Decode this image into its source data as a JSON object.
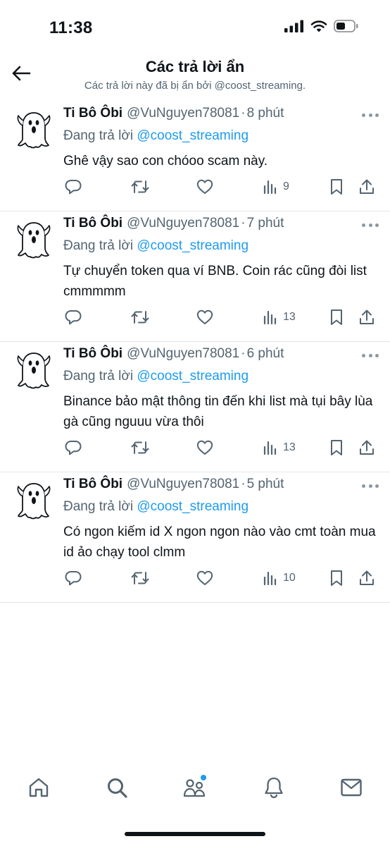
{
  "status_bar": {
    "time": "11:38"
  },
  "header": {
    "title": "Các trả lời ẩn",
    "subtitle": "Các trả lời này đã bị ẩn bởi @coost_streaming."
  },
  "replies": [
    {
      "author": "Ti Bô Ôbi",
      "handle": "@VuNguyen78081",
      "time": "8 phút",
      "replying_prefix": "Đang trả lời",
      "replying_to": "@coost_streaming",
      "text": "Ghê vậy sao con chóoo scam này.",
      "views": "9"
    },
    {
      "author": "Ti Bô Ôbi",
      "handle": "@VuNguyen78081",
      "time": "7 phút",
      "replying_prefix": "Đang trả lời",
      "replying_to": "@coost_streaming",
      "text": "Tự chuyển token qua ví BNB. Coin rác cũng đòi list cmmmmm",
      "views": "13"
    },
    {
      "author": "Ti Bô Ôbi",
      "handle": "@VuNguyen78081",
      "time": "6 phút",
      "replying_prefix": "Đang trả lời",
      "replying_to": "@coost_streaming",
      "text": "Binance bảo mật thông tin đến khi list mà tụi bây lùa gà cũng nguuu vừa thôi",
      "views": "13"
    },
    {
      "author": "Ti Bô Ôbi",
      "handle": "@VuNguyen78081",
      "time": "5 phút",
      "replying_prefix": "Đang trả lời",
      "replying_to": "@coost_streaming",
      "text": "Có ngon kiếm id X ngon ngon nào vào cmt toàn mua id ảo chạy tool clmm",
      "views": "10"
    }
  ],
  "icons": {
    "back": "arrow-left-icon",
    "more": "more-dots-icon",
    "reply": "reply-icon",
    "retweet": "retweet-icon",
    "like": "heart-icon",
    "views": "views-chart-icon",
    "bookmark": "bookmark-icon",
    "share": "share-icon",
    "nav": [
      "home-icon",
      "search-icon",
      "communities-icon",
      "notifications-icon",
      "messages-icon"
    ]
  },
  "colors": {
    "text": "#0f1419",
    "secondary": "#536471",
    "accent": "#1d9bf0",
    "divider": "#e4e7ea"
  }
}
